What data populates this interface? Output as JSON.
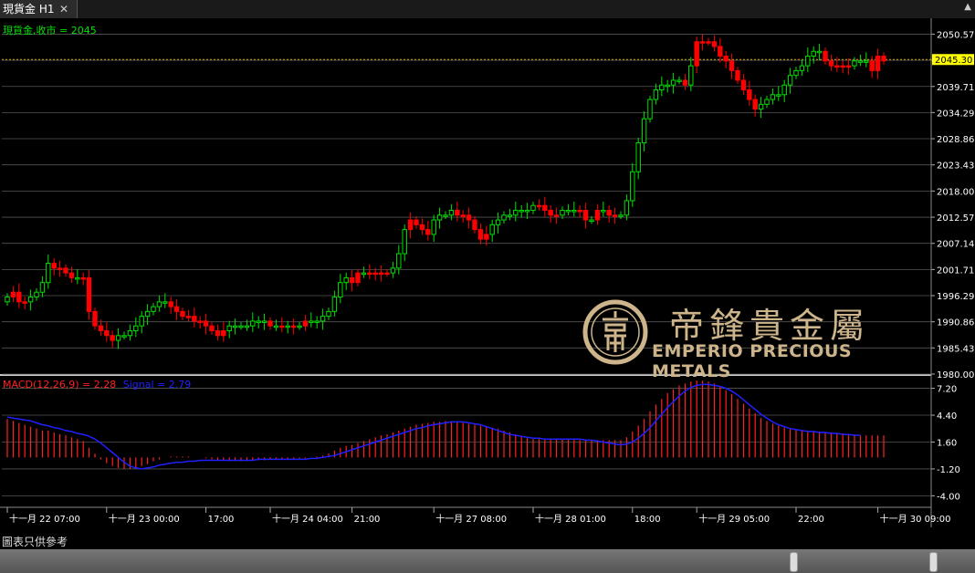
{
  "tab": {
    "title": "現貨金 H1",
    "close": "✕"
  },
  "footer_text": "圖表只供參考",
  "logo": {
    "cn": "帝鋒貴金屬",
    "en": "EMPERIO PRECIOUS METALS"
  },
  "colors": {
    "bull": "#00e000",
    "bear": "#ff0000",
    "signal": "#2020ff",
    "macd": "#ff2020",
    "price_line": "#d4a020"
  },
  "chart_data": [
    {
      "type": "candlestick",
      "title": "現貨金,收市 = 2045",
      "y_ticks": [
        "2050.57",
        "2045.14",
        "2039.71",
        "2034.29",
        "2028.86",
        "2023.43",
        "2018.00",
        "2012.57",
        "2007.14",
        "2001.71",
        "1996.29",
        "1990.86",
        "1985.43",
        "1980.00"
      ],
      "ylim": [
        1980.0,
        2053.3
      ],
      "current_price": 2045.3,
      "current_price_label": "2045.30",
      "x_ticks": [
        {
          "label": "十一月 22 07:00",
          "bar": 0
        },
        {
          "label": "十一月 23 00:00",
          "bar": 17
        },
        {
          "label": "17:00",
          "bar": 34
        },
        {
          "label": "十一月 24 04:00",
          "bar": 45
        },
        {
          "label": "21:00",
          "bar": 59
        },
        {
          "label": "十一月 27 08:00",
          "bar": 73
        },
        {
          "label": "十一月 28 01:00",
          "bar": 90
        },
        {
          "label": "18:00",
          "bar": 107
        },
        {
          "label": "十一月 29 05:00",
          "bar": 118
        },
        {
          "label": "22:00",
          "bar": 135
        },
        {
          "label": "十一月 30 09:00",
          "bar": 149
        }
      ],
      "close": [
        1996,
        1997,
        1995,
        1995,
        1996,
        1997,
        1999,
        2003,
        2002,
        2002,
        2001,
        2000,
        2000,
        2000,
        1993,
        1990,
        1989,
        1988,
        1987,
        1988,
        1988,
        1989,
        1990,
        1992,
        1993,
        1994,
        1995,
        1995,
        1994,
        1993,
        1992,
        1992,
        1991,
        1991,
        1990,
        1989,
        1988,
        1989,
        1990,
        1990,
        1990,
        1990,
        1991,
        1991,
        1991,
        1990,
        1990,
        1990,
        1990,
        1990,
        1990,
        1991,
        1991,
        1991,
        1992,
        1993,
        1996,
        1999,
        2000,
        1999,
        2001,
        2001,
        2001,
        2001,
        2001,
        2001,
        2002,
        2005,
        2010,
        2012,
        2011,
        2010,
        2009,
        2012,
        2013,
        2013,
        2014,
        2013,
        2013,
        2012,
        2010,
        2008,
        2009,
        2011,
        2012,
        2013,
        2013,
        2014,
        2014,
        2014,
        2015,
        2015,
        2014,
        2013,
        2013,
        2014,
        2014,
        2014,
        2014,
        2012,
        2012,
        2014,
        2014,
        2013,
        2013,
        2013,
        2016,
        2022,
        2028,
        2033,
        2037,
        2039,
        2040,
        2040,
        2041,
        2041,
        2040,
        2044,
        2049,
        2049,
        2049,
        2048,
        2046,
        2045,
        2043,
        2041,
        2039,
        2037,
        2035,
        2036,
        2037,
        2038,
        2038,
        2040,
        2042,
        2043,
        2044,
        2046,
        2047,
        2047,
        2045,
        2044,
        2044,
        2044,
        2044,
        2045,
        2045,
        2045,
        2043,
        2046,
        2045
      ],
      "bear_bars": [
        1,
        3,
        9,
        10,
        11,
        13,
        14,
        15,
        16,
        28,
        29,
        30,
        31,
        32,
        33,
        34,
        35,
        36,
        37,
        45,
        47,
        49,
        51,
        59,
        60,
        62,
        63,
        64,
        65,
        69,
        70,
        71,
        72,
        78,
        79,
        80,
        81,
        82,
        91,
        92,
        93,
        94,
        98,
        99,
        101,
        103,
        104,
        118,
        119,
        120,
        121,
        122,
        123,
        124,
        125,
        126,
        127,
        128,
        141,
        142,
        143,
        144,
        149
      ],
      "indicator": {
        "name": "MACD",
        "label": "MACD(12,26,9) = 2.28",
        "signal_label": "Signal = 2.79",
        "y_ticks": [
          "7.20",
          "4.40",
          "1.60",
          "-1.20",
          "-4.00"
        ],
        "ylim": [
          -5.2,
          8.3
        ],
        "macd": [
          4.0,
          3.8,
          3.6,
          3.4,
          3.2,
          3.0,
          2.8,
          2.8,
          2.6,
          2.4,
          2.3,
          2.1,
          1.9,
          1.7,
          1.0,
          0.4,
          -0.2,
          -0.6,
          -0.9,
          -1.1,
          -1.2,
          -1.2,
          -1.1,
          -0.9,
          -0.7,
          -0.4,
          -0.2,
          0.0,
          0.1,
          0.1,
          0.1,
          0.1,
          0.0,
          0.0,
          -0.1,
          -0.2,
          -0.3,
          -0.3,
          -0.4,
          -0.4,
          -0.4,
          -0.4,
          -0.3,
          -0.3,
          -0.3,
          -0.2,
          -0.2,
          -0.2,
          -0.2,
          -0.2,
          -0.1,
          -0.1,
          0.0,
          0.1,
          0.2,
          0.4,
          0.7,
          1.0,
          1.2,
          1.3,
          1.5,
          1.7,
          1.9,
          2.1,
          2.3,
          2.4,
          2.6,
          2.8,
          3.0,
          3.2,
          3.4,
          3.5,
          3.6,
          3.7,
          3.7,
          3.8,
          3.8,
          3.7,
          3.6,
          3.5,
          3.4,
          3.3,
          3.2,
          3.1,
          3.0,
          2.8,
          2.6,
          2.4,
          2.2,
          2.0,
          1.9,
          1.9,
          1.9,
          1.9,
          1.9,
          1.9,
          1.9,
          1.9,
          1.8,
          1.8,
          1.8,
          1.8,
          1.8,
          1.8,
          1.8,
          1.8,
          2.1,
          2.7,
          3.3,
          4.0,
          4.8,
          5.5,
          6.1,
          6.7,
          7.1,
          7.5,
          7.7,
          7.9,
          8.0,
          8.0,
          7.9,
          7.7,
          7.4,
          7.0,
          6.6,
          6.1,
          5.6,
          5.1,
          4.6,
          4.1,
          3.8,
          3.5,
          3.3,
          3.1,
          3.0,
          2.9,
          2.8,
          2.8,
          2.7,
          2.7,
          2.6,
          2.6,
          2.5,
          2.5,
          2.4,
          2.4,
          2.3,
          2.3,
          2.3,
          2.3,
          2.3
        ],
        "signal": [
          4.2,
          4.1,
          4.0,
          3.9,
          3.8,
          3.6,
          3.4,
          3.3,
          3.1,
          3.0,
          2.8,
          2.7,
          2.5,
          2.4,
          2.2,
          1.9,
          1.5,
          1.0,
          0.5,
          0.0,
          -0.5,
          -0.9,
          -1.1,
          -1.2,
          -1.1,
          -1.0,
          -0.8,
          -0.7,
          -0.6,
          -0.5,
          -0.5,
          -0.4,
          -0.4,
          -0.3,
          -0.3,
          -0.3,
          -0.3,
          -0.3,
          -0.3,
          -0.3,
          -0.3,
          -0.3,
          -0.3,
          -0.2,
          -0.2,
          -0.2,
          -0.2,
          -0.2,
          -0.2,
          -0.2,
          -0.2,
          -0.2,
          -0.1,
          -0.1,
          0.0,
          0.1,
          0.2,
          0.4,
          0.6,
          0.8,
          1.0,
          1.2,
          1.4,
          1.6,
          1.8,
          2.0,
          2.2,
          2.4,
          2.6,
          2.8,
          3.0,
          3.1,
          3.3,
          3.4,
          3.5,
          3.6,
          3.7,
          3.7,
          3.7,
          3.6,
          3.5,
          3.4,
          3.2,
          3.0,
          2.8,
          2.6,
          2.4,
          2.3,
          2.2,
          2.1,
          2.0,
          2.0,
          1.9,
          1.9,
          1.9,
          1.9,
          1.9,
          1.9,
          1.9,
          1.8,
          1.8,
          1.7,
          1.6,
          1.5,
          1.4,
          1.3,
          1.4,
          1.6,
          2.0,
          2.5,
          3.1,
          3.8,
          4.5,
          5.2,
          5.8,
          6.4,
          6.9,
          7.3,
          7.5,
          7.6,
          7.6,
          7.5,
          7.4,
          7.2,
          6.9,
          6.5,
          6.0,
          5.5,
          5.0,
          4.5,
          4.1,
          3.7,
          3.4,
          3.2,
          3.0,
          2.9,
          2.8,
          2.7,
          2.7,
          2.6,
          2.6,
          2.5,
          2.5,
          2.4,
          2.4,
          2.3,
          2.3
        ]
      }
    }
  ]
}
